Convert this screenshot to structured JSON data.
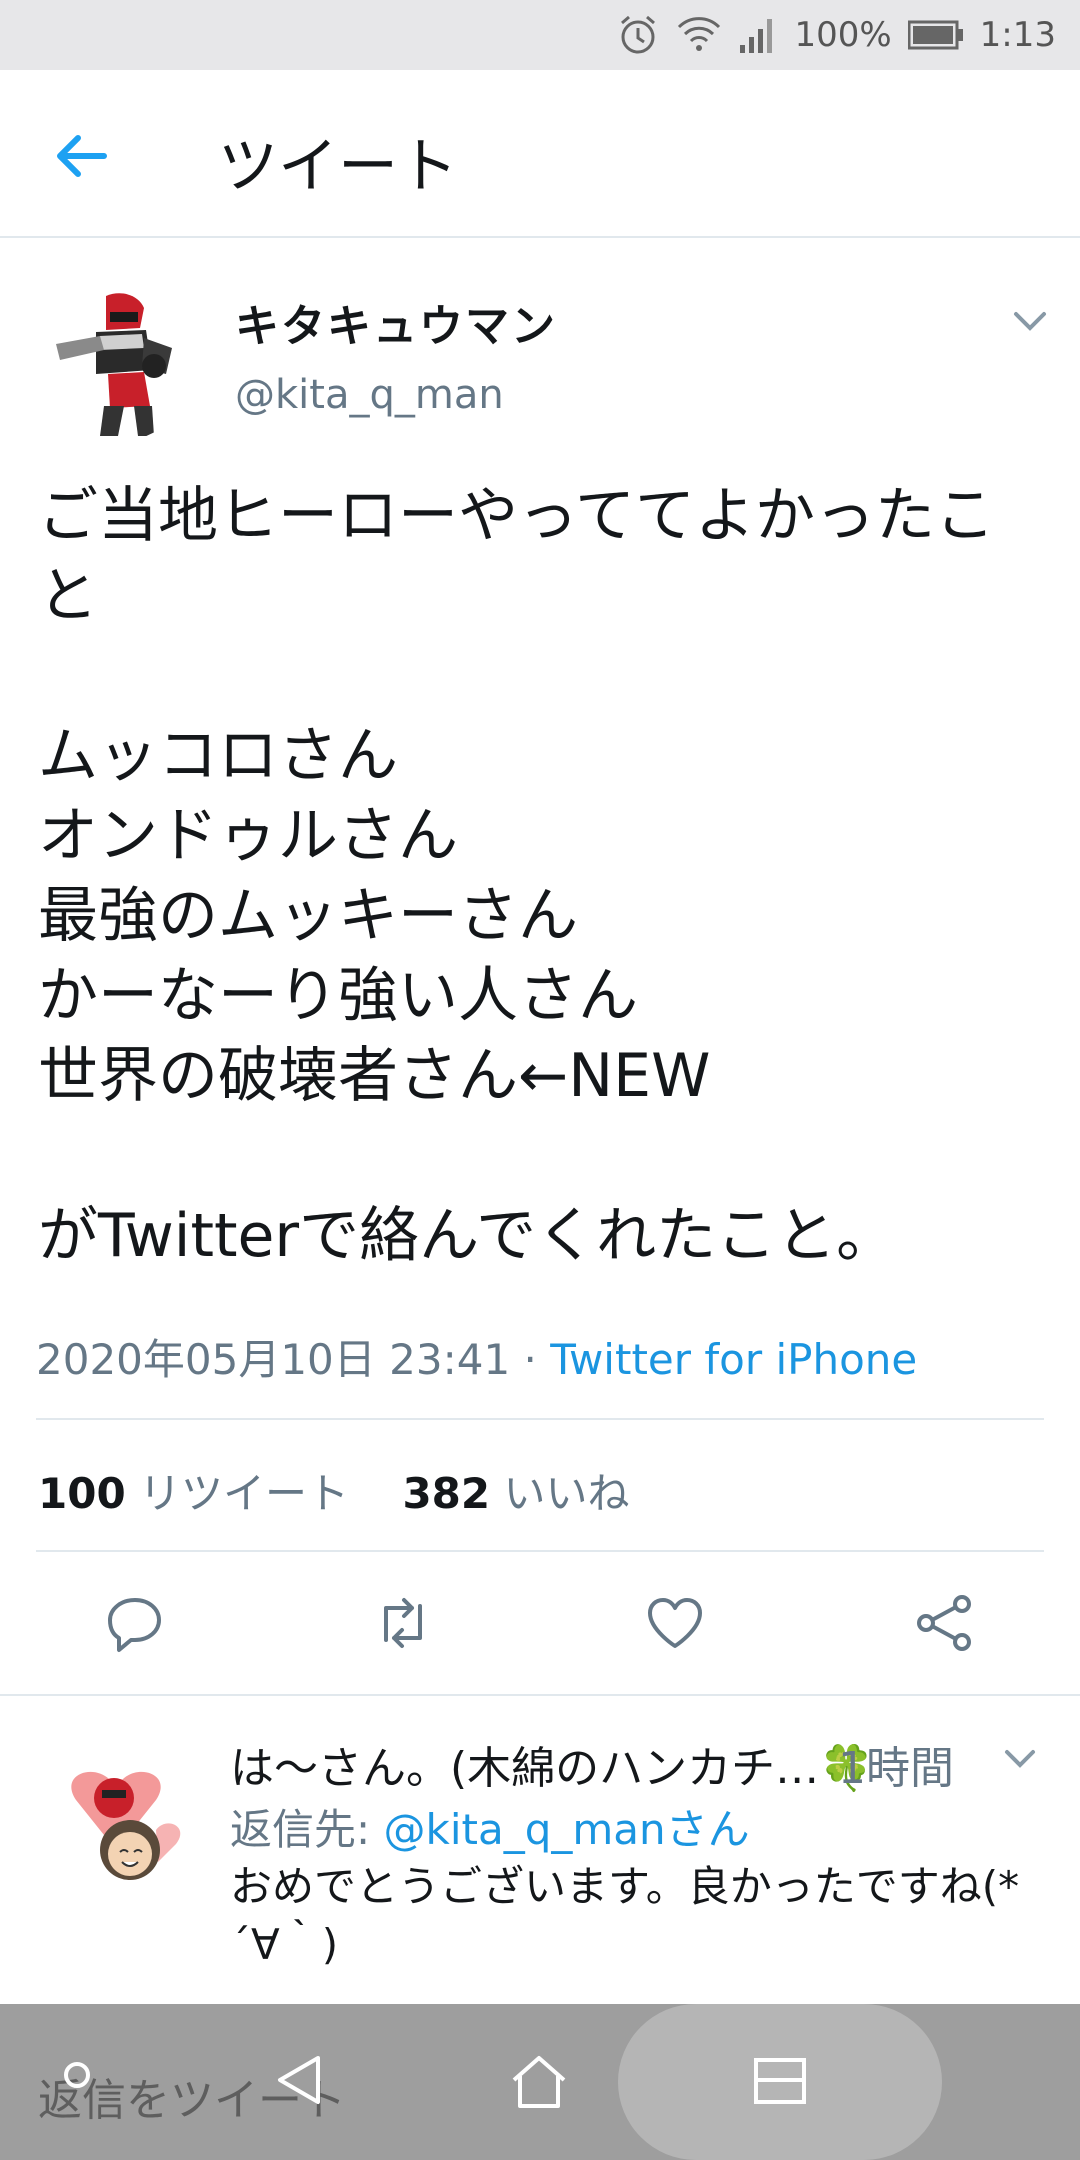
{
  "status_bar": {
    "battery": "100%",
    "time": "1:13",
    "icons": [
      "alarm-icon",
      "wifi-icon",
      "signal-icon",
      "battery-icon"
    ]
  },
  "app_bar": {
    "title": "ツイート",
    "back_icon": "back-arrow-icon"
  },
  "tweet": {
    "display_name": "キタキュウマン",
    "handle": "@kita_q_man",
    "text": "ご当地ヒーローやっててよかったこと\n\nムッコロさん\nオンドゥルさん\n最強のムッキーさん\nかーなーり強い人さん\n世界の破壊者さん←NEW\n\nがTwitterで絡んでくれたこと。",
    "timestamp": "2020年05月10日 23:41",
    "separator": "·",
    "source": "Twitter for iPhone",
    "retweets_count": "100",
    "retweets_label": "リツイート",
    "likes_count": "382",
    "likes_label": "いいね"
  },
  "actions": [
    "reply-icon",
    "retweet-icon",
    "like-icon",
    "share-icon"
  ],
  "reply": {
    "display_name": "は〜さん。(木綿のハンカチ…🍀",
    "time": "1時間",
    "reply_to_label": "返信先: ",
    "reply_to_handle": "@kita_q_man",
    "reply_to_suffix": "さん",
    "text": "おめでとうございます。良かったですね(*´∀｀)"
  },
  "compose": {
    "placeholder": "返信をツイート"
  },
  "colors": {
    "accent": "#1b95e0",
    "secondary_text": "#657786",
    "divider": "#e1e8ed"
  }
}
